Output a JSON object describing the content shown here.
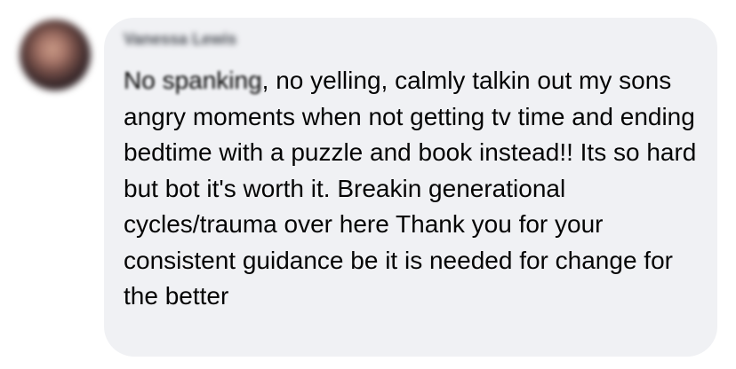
{
  "comment": {
    "author_name": "Vanessa Lewis",
    "text_blurred": "No spanking",
    "text_rest": ", no yelling, calmly talkin out my sons angry moments when not getting tv time and ending bedtime with a puzzle and book instead!! Its so hard but bot it's worth it. Breakin generational cycles/trauma over here Thank you for your consistent guidance be it is needed for change for the better"
  },
  "colors": {
    "bubble": "#f0f1f4",
    "text": "#050505",
    "author": "#4b4f56"
  }
}
